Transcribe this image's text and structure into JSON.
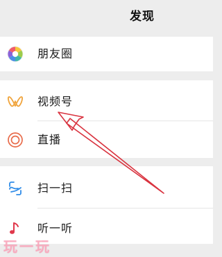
{
  "header": {
    "title": "发现"
  },
  "menu": {
    "moments": {
      "label": "朋友圈",
      "icon": "moments-icon"
    },
    "channels": {
      "label": "视频号",
      "icon": "channels-icon"
    },
    "live": {
      "label": "直播",
      "icon": "live-icon"
    },
    "scan": {
      "label": "扫一扫",
      "icon": "scan-icon"
    },
    "listen": {
      "label": "听一听",
      "icon": "listen-icon"
    }
  },
  "annotation": {
    "arrow_color": "#d9333f",
    "arrow_target": "视频号"
  },
  "watermark": {
    "text": "玩一玩"
  },
  "colors": {
    "background": "#ededed",
    "cell": "#ffffff",
    "channels_icon": "#f0a43c",
    "live_icon": "#e86b4a",
    "scan_icon": "#2f8ce8",
    "listen_icon": "#e0384b"
  }
}
